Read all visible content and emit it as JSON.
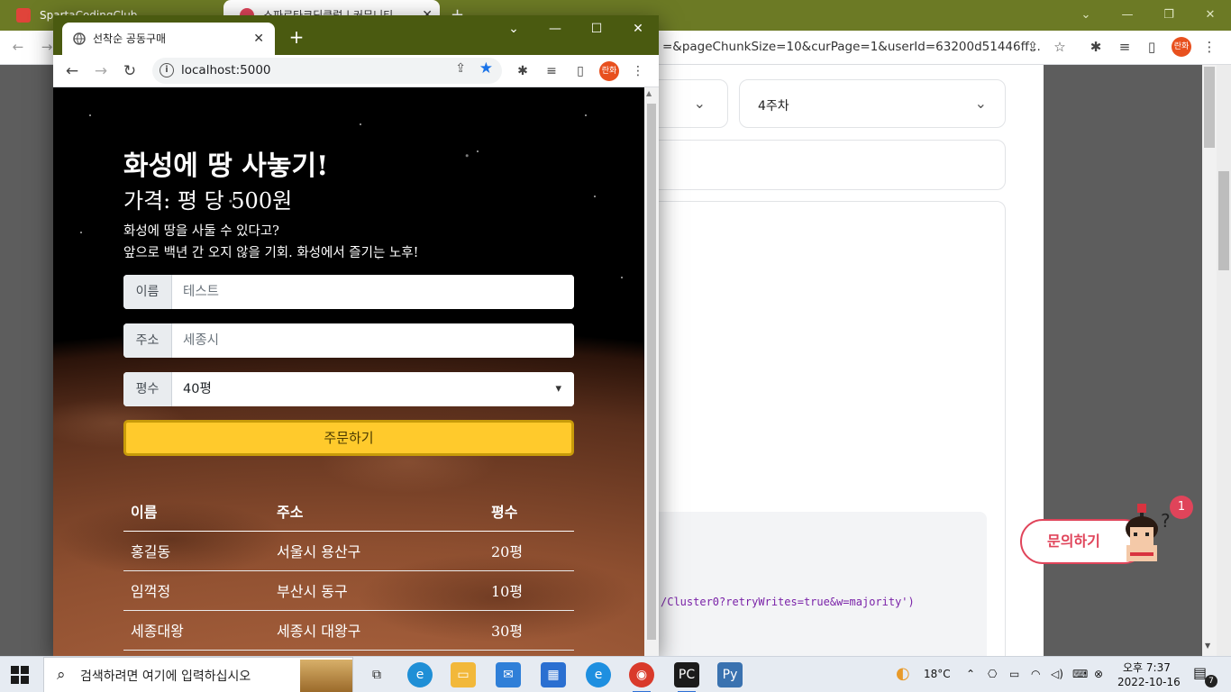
{
  "bg_browser": {
    "tabs": [
      {
        "label": "SpartaCodingClub"
      },
      {
        "label": "스파르타코딩클럽 | 커뮤니티"
      }
    ],
    "url": "=&pageChunkSize=10&curPage=1&userId=63200d51446ff...",
    "profile_label": "란화",
    "week_select": "4주차",
    "code_snippet": "/Cluster0?retryWrites=true&w=majority')",
    "inquiry_label": "문의하기",
    "notification_count": "1"
  },
  "fg_browser": {
    "tab_title": "선착순 공동구매",
    "url": "localhost:5000",
    "profile_label": "란화"
  },
  "page": {
    "title": "화성에 땅 사놓기!",
    "price": "가격: 평 당 500원",
    "description_line1": "화성에 땅을 사둘 수 있다고?",
    "description_line2": "앞으로 백년 간 오지 않을 기회. 화성에서 즐기는 노후!",
    "form": {
      "name_label": "이름",
      "name_placeholder": "테스트",
      "address_label": "주소",
      "address_placeholder": "세종시",
      "size_label": "평수",
      "size_selected": "40평",
      "submit_label": "주문하기"
    },
    "table": {
      "headers": [
        "이름",
        "주소",
        "평수"
      ],
      "rows": [
        [
          "홍길동",
          "서울시 용산구",
          "20평"
        ],
        [
          "임꺽정",
          "부산시 동구",
          "10평"
        ],
        [
          "세종대왕",
          "세종시 대왕구",
          "30평"
        ]
      ]
    }
  },
  "taskbar": {
    "search_placeholder": "검색하려면 여기에 입력하십시오",
    "temperature": "18°C",
    "time": "오후 7:37",
    "date": "2022-10-16",
    "notification_count": "7"
  },
  "colors": {
    "bg_tabstrip": "#6c7a25",
    "fg_tabstrip": "#4a5a10",
    "order_button": "#ffca2c",
    "inquiry_accent": "#e0445a",
    "profile_avatar": "#e8501e"
  }
}
